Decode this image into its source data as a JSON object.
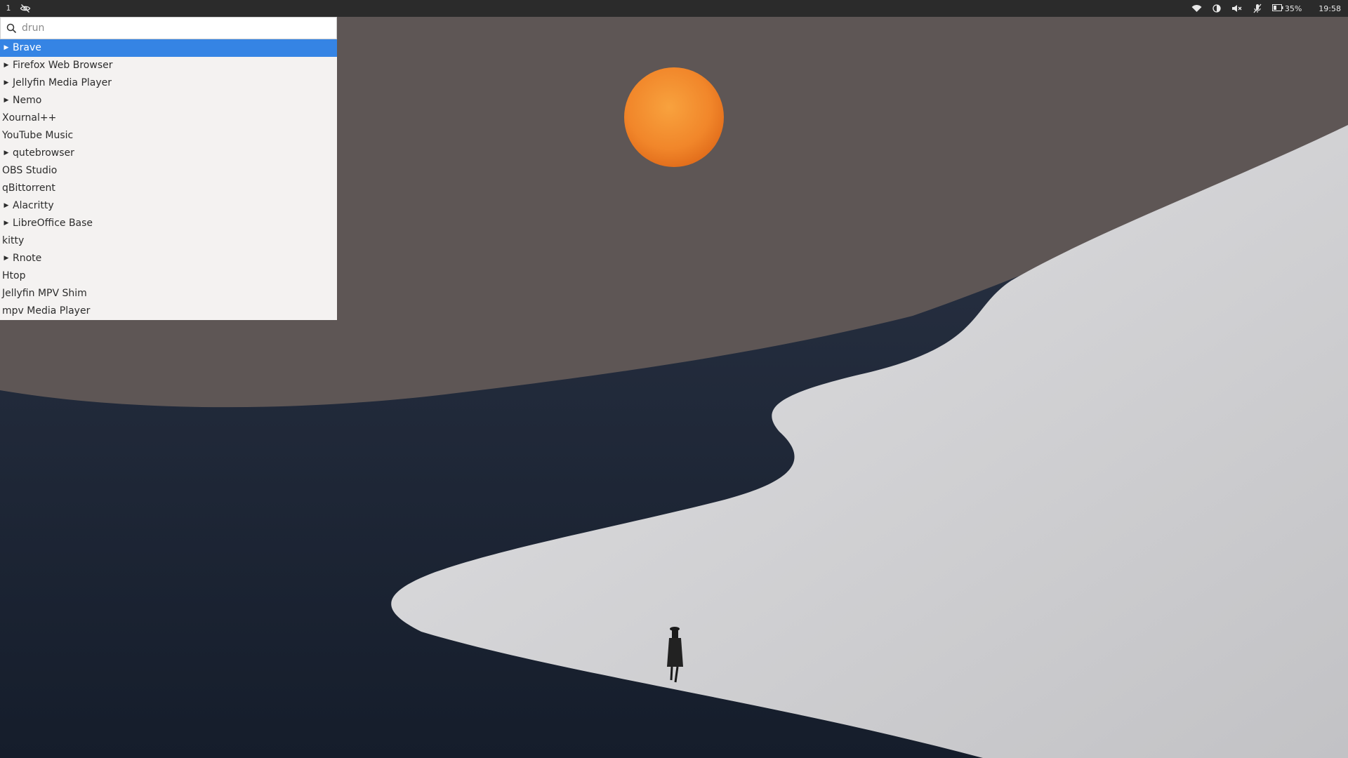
{
  "topbar": {
    "workspace": "1",
    "battery_text": "35%",
    "clock": "19:58",
    "icons": [
      "eye-slash-icon",
      "wifi-icon",
      "night-light-icon",
      "volume-muted-icon",
      "mic-muted-icon",
      "battery-icon"
    ]
  },
  "launcher": {
    "search_value": "",
    "search_placeholder": "drun",
    "entries": [
      {
        "label": "Brave",
        "expandable": true,
        "selected": true
      },
      {
        "label": "Firefox Web Browser",
        "expandable": true
      },
      {
        "label": "Jellyfin Media Player",
        "expandable": true
      },
      {
        "label": "Nemo",
        "expandable": true
      },
      {
        "label": "Xournal++",
        "expandable": false
      },
      {
        "label": "YouTube Music",
        "expandable": false
      },
      {
        "label": "qutebrowser",
        "expandable": true
      },
      {
        "label": "OBS Studio",
        "expandable": false
      },
      {
        "label": "qBittorrent",
        "expandable": false
      },
      {
        "label": "Alacritty",
        "expandable": true
      },
      {
        "label": "LibreOffice Base",
        "expandable": true
      },
      {
        "label": "kitty",
        "expandable": false
      },
      {
        "label": "Rnote",
        "expandable": true
      },
      {
        "label": "Htop",
        "expandable": false
      },
      {
        "label": "Jellyfin MPV Shim",
        "expandable": false
      },
      {
        "label": "mpv Media Player",
        "expandable": false
      }
    ]
  },
  "colors": {
    "selection": "#3584e4",
    "topbar": "#2b2b2b",
    "sky": "#5e5655",
    "moon": "#f2892a",
    "dune_dark": "#1f2839",
    "dune_light": "#d4d4d6"
  }
}
